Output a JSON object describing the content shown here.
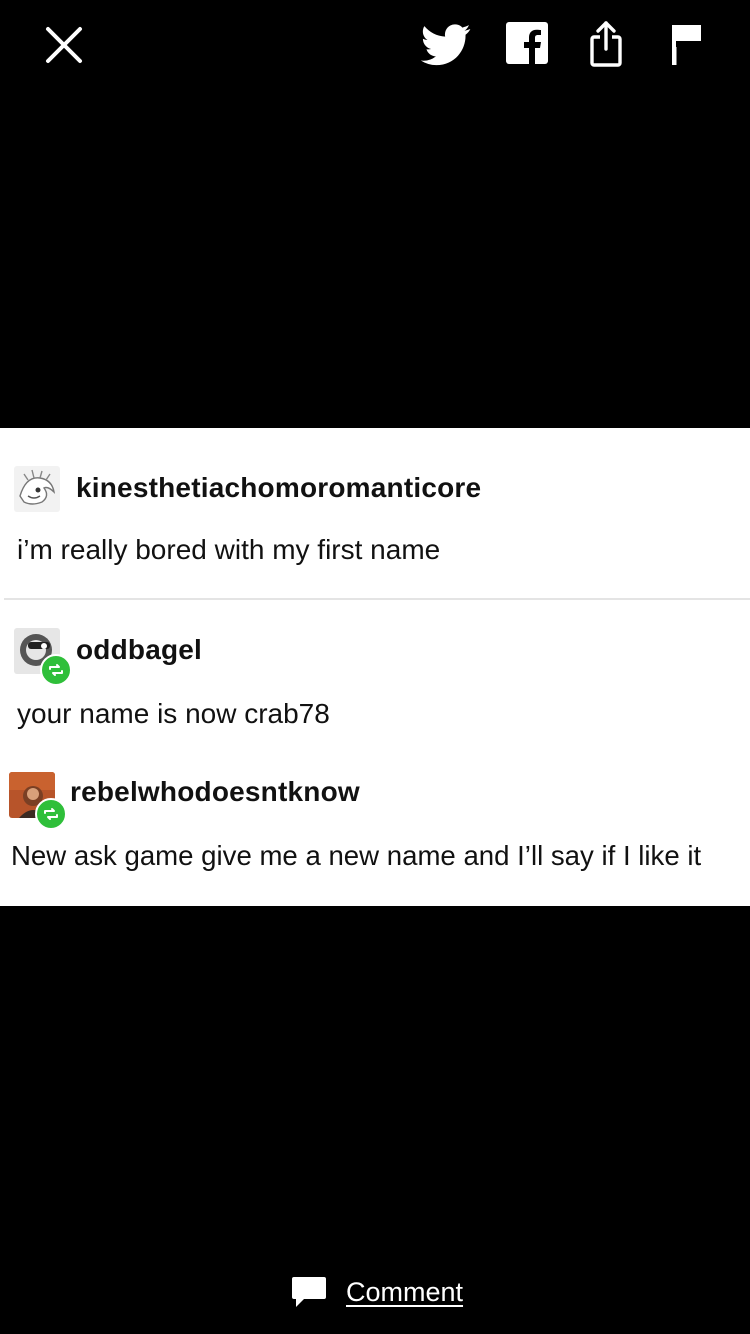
{
  "topbar": {
    "icons": [
      "close-icon",
      "twitter-icon",
      "facebook-icon",
      "share-icon",
      "flag-icon"
    ]
  },
  "posts": [
    {
      "username": "kinesthetiachomoromanticore",
      "text": "i’m really bored with my first name",
      "reblogged": false
    },
    {
      "username": "oddbagel",
      "text": "your name is now crab78",
      "reblogged": true
    },
    {
      "username": "rebelwhodoesntknow",
      "text": "New ask game give me a new name and I’ll say if I like it",
      "reblogged": true
    }
  ],
  "footer": {
    "comment_label": "Comment"
  },
  "colors": {
    "background": "#000000",
    "card": "#ffffff",
    "reblog_badge": "#2fbf3a"
  }
}
